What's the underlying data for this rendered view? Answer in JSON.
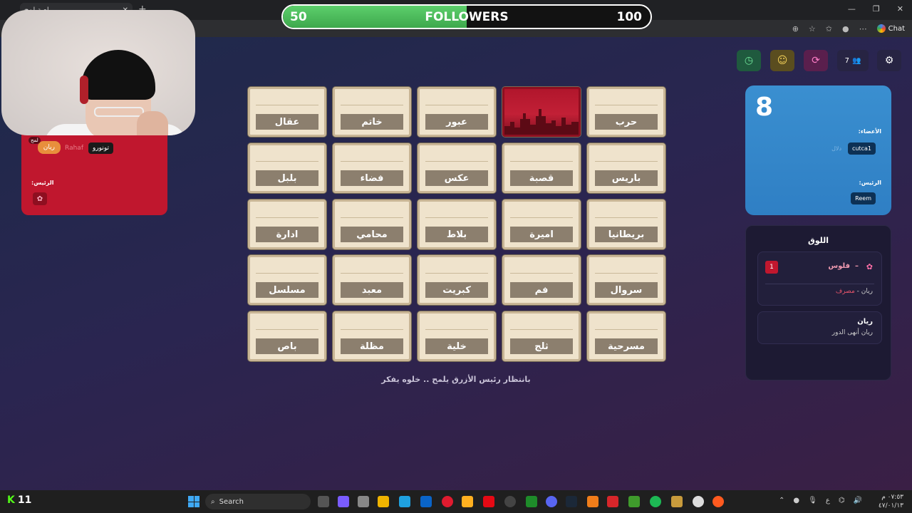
{
  "browser": {
    "tab_title": "لعبة لمح",
    "new_tab": "+",
    "close": "✕",
    "chat_label": "Chat"
  },
  "followers": {
    "current": "50",
    "title": "FOLLOWERS",
    "goal": "100",
    "progress_fraction": 0.5
  },
  "red_team": {
    "members": [
      "تونورو",
      "Rahaf",
      "ريان"
    ],
    "badge": "لمح",
    "leader_label": ":الرئيس"
  },
  "toolbar": {
    "member_count": "7"
  },
  "grid": {
    "cards": [
      {
        "word": "حرب",
        "state": "hidden"
      },
      {
        "word": "",
        "state": "revealed-red"
      },
      {
        "word": "عبور",
        "state": "hidden"
      },
      {
        "word": "خاتم",
        "state": "hidden"
      },
      {
        "word": "عقال",
        "state": "hidden"
      },
      {
        "word": "باريس",
        "state": "hidden"
      },
      {
        "word": "قصبة",
        "state": "hidden"
      },
      {
        "word": "عكس",
        "state": "hidden"
      },
      {
        "word": "فضاء",
        "state": "hidden"
      },
      {
        "word": "بلبل",
        "state": "hidden"
      },
      {
        "word": "بريطانيا",
        "state": "hidden"
      },
      {
        "word": "اميرة",
        "state": "hidden"
      },
      {
        "word": "بلاط",
        "state": "hidden"
      },
      {
        "word": "محامي",
        "state": "hidden"
      },
      {
        "word": "ادارة",
        "state": "hidden"
      },
      {
        "word": "سروال",
        "state": "hidden"
      },
      {
        "word": "فم",
        "state": "hidden"
      },
      {
        "word": "كبريت",
        "state": "hidden"
      },
      {
        "word": "معبد",
        "state": "hidden"
      },
      {
        "word": "مسلسل",
        "state": "hidden"
      },
      {
        "word": "مسرحية",
        "state": "hidden"
      },
      {
        "word": "ثلج",
        "state": "hidden"
      },
      {
        "word": "خلية",
        "state": "hidden"
      },
      {
        "word": "مظلة",
        "state": "hidden"
      },
      {
        "word": "باص",
        "state": "hidden"
      }
    ],
    "status": "بانتظار رئيس الأزرق يلمح .. خلوه يفكر"
  },
  "blue_team": {
    "score": "8",
    "members_label": ":الأعضاء",
    "members": [
      "cutca1",
      "دلال"
    ],
    "leader_label": ":الرئيس",
    "leader": "Reem"
  },
  "log": {
    "title": "اللوق",
    "entries": [
      {
        "count": "1",
        "word": "فلوس",
        "dash": "–",
        "by": "ريان",
        "action": "مصرف"
      },
      {
        "name": "ريان",
        "message": "ريان أنهى الدور"
      }
    ]
  },
  "taskbar": {
    "kick_count": "11",
    "search_placeholder": "Search",
    "time": "٠٧:٥٣ م",
    "date": "٤٧/٠١/١٣",
    "lang": "ع"
  },
  "colors": {
    "red_team": "#c0172e",
    "blue_team": "#3a8fd0",
    "followers_fill": "#4bbd5b"
  }
}
